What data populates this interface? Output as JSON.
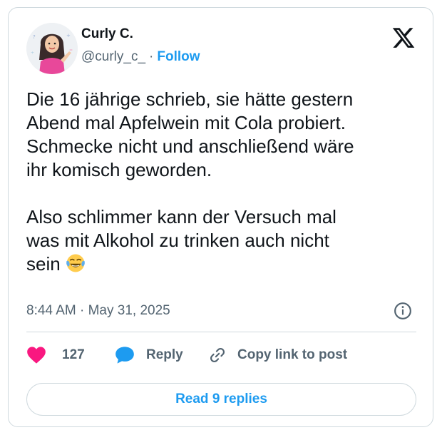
{
  "author": {
    "name": "Curly C.",
    "handle": "@curly_c_",
    "separator": "·",
    "follow_label": "Follow",
    "avatar_icon": "profile-avatar-cartoon-woman"
  },
  "platform": {
    "logo_icon": "x-logo-icon"
  },
  "tweet": {
    "lines_paragraph_1": [
      "Die 16 jährige schrieb, sie hätte gestern",
      "Abend mal Apfelwein mit Cola probiert.",
      "Schmecke nicht und anschließend wäre",
      "ihr komisch geworden."
    ],
    "lines_paragraph_2": [
      "Also schlimmer kann der Versuch mal",
      "was mit Alkohol zu trinken auch nicht",
      "sein"
    ],
    "emoji_icon": "face-with-tears-of-joy-emoji"
  },
  "meta": {
    "time": "8:44 AM",
    "separator": "·",
    "date": "May 31, 2025",
    "info_icon": "info-icon"
  },
  "actions": {
    "like_count": "127",
    "reply_label": "Reply",
    "copy_label": "Copy link to post"
  },
  "replies_button": {
    "label": "Read 9 replies"
  },
  "colors": {
    "accent": "#1d9bf0",
    "like": "#f91880",
    "text": "#0f1419",
    "muted": "#536471",
    "border": "#cfd9de"
  }
}
